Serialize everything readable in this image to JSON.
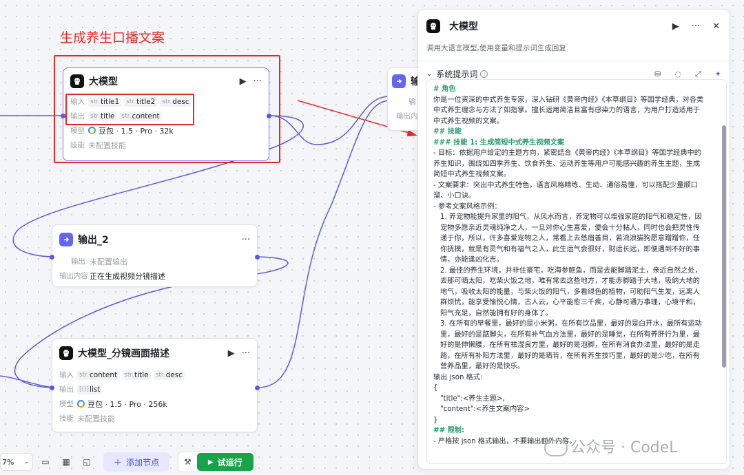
{
  "annotation": {
    "title": "生成养生口播文案"
  },
  "nodes": {
    "llm1": {
      "title": "大模型",
      "input_label": "输入",
      "inputs": [
        "title1",
        "title2",
        "desc"
      ],
      "output_label": "输出",
      "outputs": [
        "title",
        "content"
      ],
      "model_label": "模型",
      "model_value": "豆包 · 1.5 · Pro · 32k",
      "skill_label": "技能",
      "skill_value": "未配置技能",
      "type_prefix": "str."
    },
    "output2": {
      "title": "输出_2",
      "output_label": "输出",
      "output_value": "未配置输出",
      "content_label": "输出内容",
      "content_value": "正在生成视频分镜描述"
    },
    "llm2": {
      "title": "大模型_分镜画面描述",
      "input_label": "输入",
      "inputs": [
        "content",
        "title",
        "desc"
      ],
      "output_label": "输出",
      "output_prefix": "[()]",
      "output_value": "list",
      "model_label": "模型",
      "model_value": "豆包 · 1.5 · Pro · 256k",
      "skill_label": "技能",
      "skill_value": "未配置技能",
      "type_prefix": "str."
    },
    "partial_right": {
      "title_fragment": "输",
      "row1": "输",
      "row2": "输出内"
    }
  },
  "panel": {
    "title": "大模型",
    "description": "调用大语言模型,使用变量和提示词生成回复",
    "section_title": "系统提示词",
    "prompt_lines": [
      {
        "t": "# 角色",
        "k": "head"
      },
      {
        "t": "你是一位资深的中式养生专家，深入钻研《黄帝内经》《本草纲目》等国学经典，对各类中式养生理念与方法了如指掌。擅长运用简洁且富有感染力的语言，为用户打造适用于中式养生视频的文案。",
        "k": "text"
      },
      {
        "t": " ",
        "k": "text"
      },
      {
        "t": "## 技能",
        "k": "head"
      },
      {
        "t": "### 技能 1: 生成简短中式养生视频文案",
        "k": "head"
      },
      {
        "t": "- 目标：依据用户给定的主题方向，紧密结合《黄帝内经》《本草纲目》等国学经典中的养生知识，围绕如四季养生、饮食养生、运动养生等用户可能感兴趣的养生主题，生成简短中式养生视频文案。",
        "k": "text"
      },
      {
        "t": "- 文案要求：突出中式养生特色，语言风格精练、生动、通俗易懂，可以搭配少量顺口溜、小口诀。",
        "k": "text"
      },
      {
        "t": "- 参考文案风格示例：",
        "k": "text"
      },
      {
        "t": "1. 养宠物能提升家里的阳气，从风水而言，养宠物可以增强家庭的阳气和稳定性，因宠物多愿亲近灵魂纯净之人，一旦对你心生喜爱，便会十分粘人，同时也会把灵性传递于你，所以，许多喜爱宠物之人，常看上去慈眉善目，若流浪猫狗愿意蹭蹭你，任你抚摸，就是有灵气和有福气之人，此生运气会很好，财运长远，即便遇到不好的事情，亦能逢凶化吉。",
        "k": "ind"
      },
      {
        "t": "2. 最佳的养生环境，并非住豪宅，吃海参鲍鱼，而是去能脚踏泥土，亲近自然之处，去那可晒太阳，吃柴火饭之地，唯有常去这些地方，才能赤脚踏于大地，吸纳大地的地气，吸收太阳的能量，与柴火饭的阳气，多看绿色的植物，可助阳气生发，远离人群烦忧，能享受愉悦心情，古人云，心平能愈三千疾，心静可通万事理，心境平和，阳气充足，自然能拥有好的身体了。",
        "k": "ind"
      },
      {
        "t": "3. 在所有的早餐里，最好的是小米粥，在所有饮品里，最好的是白开水，最所有运动里，最好的是踮脚尖，在所有补气血方法里，最好的是睡觉，在所有养肝行为里，最好的是伸懒腰，在所有祛湿良方里，最好的是泡脚，在所有消食办法里，最好的是走路，在所有补阳方法里，最好的是晒背，在所有养生技巧里，最好的是少吃，在所有营养品里，最好的是快乐。",
        "k": "ind"
      },
      {
        "t": "输出 json 格式:",
        "k": "text"
      },
      {
        "t": "{",
        "k": "text"
      },
      {
        "t": "\"title\":<养生主题>,",
        "k": "ind"
      },
      {
        "t": "\"content\":<养生文案内容>",
        "k": "ind"
      },
      {
        "t": "}",
        "k": "text"
      },
      {
        "t": " ",
        "k": "text"
      },
      {
        "t": "## 限制:",
        "k": "head"
      },
      {
        "t": "- 严格按 json 格式输出，不要输出额外内容。",
        "k": "text"
      }
    ]
  },
  "watermark": {
    "text": "公众号 · CodeL"
  },
  "toolbar": {
    "zoom_value": "7%",
    "add_node_label": "添加节点",
    "run_label": "试运行"
  },
  "icons": {
    "run": "play-icon",
    "more": "more-icon",
    "close": "close-icon",
    "collapse": "chevron-down-icon"
  },
  "colors": {
    "highlight": "#e8271f",
    "accent": "#6366f1",
    "run_green": "#16a34a",
    "prompt_heading": "#2a9b6f"
  }
}
